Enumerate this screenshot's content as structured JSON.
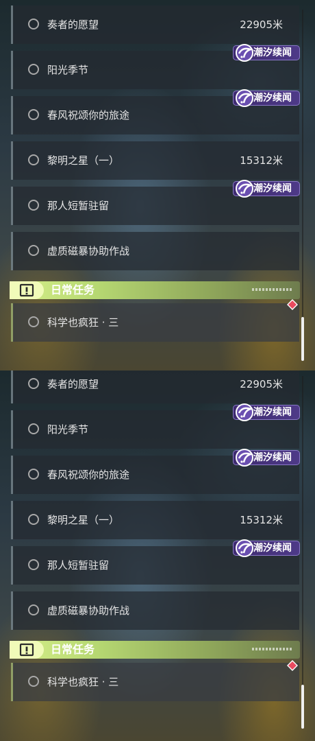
{
  "panels": [
    {
      "quests": [
        {
          "title": "奏者的愿望",
          "distance": "22905米"
        },
        {
          "title": "阳光季节",
          "distance": ""
        },
        {
          "title": "春风祝颂你的旅途",
          "distance": ""
        },
        {
          "title": "黎明之星（一）",
          "distance": "15312米"
        },
        {
          "title": "那人短暂驻留",
          "distance": ""
        },
        {
          "title": "虚质磁暴协助作战",
          "distance": ""
        }
      ],
      "tags": [
        {
          "label": "潮汐续闻"
        },
        {
          "label": "潮汐续闻"
        },
        {
          "label": "潮汐续闻"
        }
      ],
      "daily": {
        "header": "日常任务",
        "quest": "科学也疯狂 · 三"
      }
    },
    {
      "quests": [
        {
          "title": "奏者的愿望",
          "distance": "22905米"
        },
        {
          "title": "阳光季节",
          "distance": ""
        },
        {
          "title": "春风祝颂你的旅途",
          "distance": ""
        },
        {
          "title": "黎明之星（一）",
          "distance": "15312米"
        },
        {
          "title": "那人短暂驻留",
          "distance": ""
        },
        {
          "title": "虚质磁暴协助作战",
          "distance": ""
        }
      ],
      "tags": [
        {
          "label": "潮汐续闻"
        },
        {
          "label": "潮汐续闻"
        },
        {
          "label": "潮汐续闻"
        }
      ],
      "daily": {
        "header": "日常任务",
        "quest": "科学也疯狂 · 三"
      }
    }
  ],
  "icons": {
    "quest_status": "empty-circle-icon",
    "tag": "tidal-swirl-icon",
    "daily": "exclamation-box-icon",
    "notice": "red-diamond-icon"
  },
  "colors": {
    "tag_bg": "#4e3a88",
    "daily_accent": "#d7ef8a",
    "notice": "#e84a5f"
  }
}
